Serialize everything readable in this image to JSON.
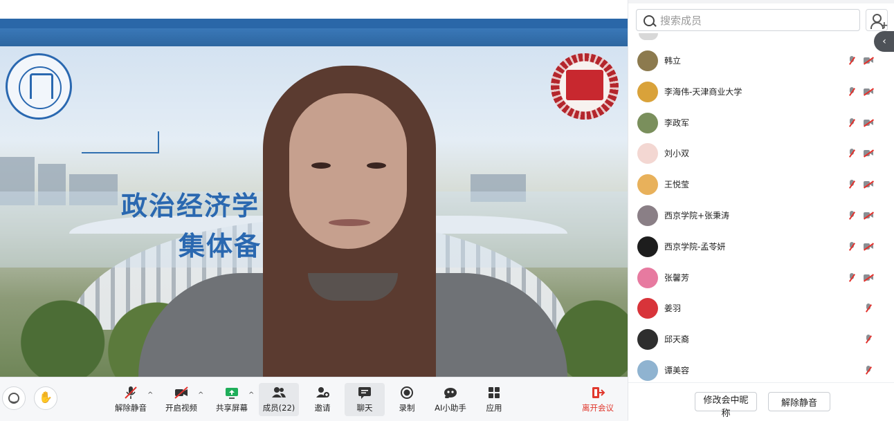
{
  "slide": {
    "title_line1": "政治经济学        联盟",
    "title_line2": "集体备            ）"
  },
  "toolbar": {
    "emoji_icon": "smiley-icon",
    "hand_icon": "raise-hand-icon",
    "unmute": "解除静音",
    "video": "开启视频",
    "share": "共享屏幕",
    "members": "成员(22)",
    "invite": "邀请",
    "chat": "聊天",
    "record": "录制",
    "ai": "AI小助手",
    "apps": "应用",
    "leave": "离开会议",
    "leave_color": "#e0382d"
  },
  "panel": {
    "search_placeholder": "搜索成员",
    "members": [
      {
        "name": "韩立",
        "avatar_color": "#8c7a4e",
        "mic_muted": true,
        "cam_off": true
      },
      {
        "name": "李海伟-天津商业大学",
        "avatar_color": "#d9a23a",
        "mic_muted": true,
        "cam_off": true
      },
      {
        "name": "李政军",
        "avatar_color": "#7a8f5c",
        "mic_muted": true,
        "cam_off": true
      },
      {
        "name": "刘小双",
        "avatar_color": "#f3d7d2",
        "mic_muted": true,
        "cam_off": true
      },
      {
        "name": "王悦莹",
        "avatar_color": "#e8b15b",
        "mic_muted": true,
        "cam_off": true
      },
      {
        "name": "西京学院+张秉涛",
        "avatar_color": "#8a7f86",
        "mic_muted": true,
        "cam_off": true
      },
      {
        "name": "西京学院-孟苓妍",
        "avatar_color": "#1d1d1d",
        "mic_muted": true,
        "cam_off": true
      },
      {
        "name": "张馨芳",
        "avatar_color": "#e77aa0",
        "mic_muted": true,
        "cam_off": true
      },
      {
        "name": "姜羽",
        "avatar_color": "#d8343a",
        "mic_muted": true,
        "cam_off": false
      },
      {
        "name": "邱天裔",
        "avatar_color": "#2e2e2e",
        "mic_muted": true,
        "cam_off": false
      },
      {
        "name": "谭美容",
        "avatar_color": "#8fb3d0",
        "mic_muted": true,
        "cam_off": false
      }
    ],
    "rename_button": "修改会中昵称",
    "unmute_all_button": "解除静音"
  }
}
